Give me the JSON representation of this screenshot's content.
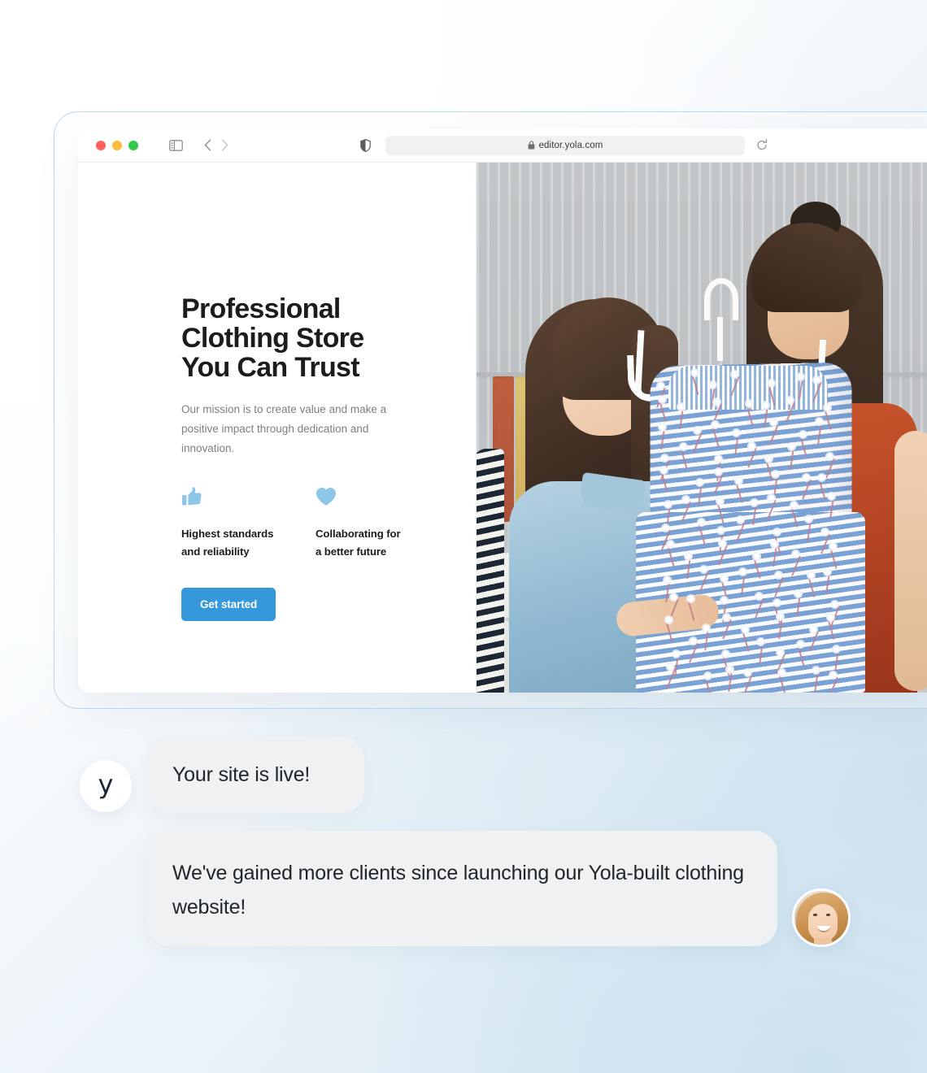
{
  "background": {
    "accent_light": "#d7e7f2",
    "accent_white": "#ffffff"
  },
  "browser": {
    "traffic_lights": [
      "close-red",
      "minimize-yellow",
      "maximize-green"
    ],
    "traffic_colors": {
      "red": "#fc6058",
      "yellow": "#fdbc40",
      "green": "#34c749"
    },
    "sidebar_toggle_icon": "sidebar-icon",
    "back_icon": "chevron-left-icon",
    "forward_icon": "chevron-right-icon",
    "shield_icon": "shield-icon",
    "lock_icon": "lock-icon",
    "reload_icon": "reload-icon",
    "url": "editor.yola.com"
  },
  "hero": {
    "headline": "Professional\nClothing Store\nYou Can Trust",
    "subtext": "Our mission is to create value and make a positive impact through dedication and innovation.",
    "features": [
      {
        "icon": "thumbs-up-icon",
        "label": "Highest standards\nand reliability"
      },
      {
        "icon": "heart-icon",
        "label": "Collaborating for\na better future"
      }
    ],
    "cta_label": "Get started",
    "cta_color": "#3498db",
    "feature_icon_color": "#8ec6ea",
    "image_alt": "two-women-holding-striped-floral-dress-on-hanger-in-clothing-store"
  },
  "chat": {
    "yola_avatar_letter": "y",
    "messages": [
      {
        "id": "site-live",
        "text": "Your site is live!",
        "sender": "yola"
      },
      {
        "id": "testimonial",
        "text": "We've gained more clients since launching our Yola-built clothing website!",
        "sender": "client"
      }
    ],
    "client_avatar_alt": "smiling-woman-portrait"
  }
}
